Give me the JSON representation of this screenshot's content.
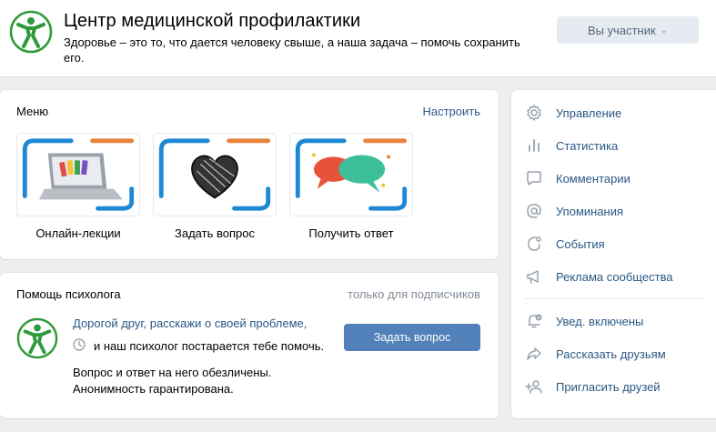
{
  "header": {
    "title": "Центр медицинской профилактики",
    "status": "Здоровье – это то, что дается человеку свыше, а наша задача – помочь сохранить его.",
    "member_button": "Вы участник"
  },
  "menu": {
    "title": "Меню",
    "configure": "Настроить",
    "tiles": [
      {
        "label": "Онлайн-лекции",
        "icon": "laptop-icon"
      },
      {
        "label": "Задать вопрос",
        "icon": "heart-icon"
      },
      {
        "label": "Получить ответ",
        "icon": "speech-bubbles-icon"
      }
    ]
  },
  "help": {
    "title": "Помощь психолога",
    "subscribers_only": "только для подписчиков",
    "line1": "Дорогой друг, расскажи о своей проблеме,",
    "line2": "и наш психолог постарается тебе помочь.",
    "line3": "Вопрос и ответ на него обезличены.",
    "line4": "Анонимность гарантирована.",
    "button": "Задать вопрос"
  },
  "sidebar": {
    "items": [
      {
        "label": "Управление",
        "icon": "gear-icon"
      },
      {
        "label": "Статистика",
        "icon": "stats-icon"
      },
      {
        "label": "Комментарии",
        "icon": "comment-icon"
      },
      {
        "label": "Упоминания",
        "icon": "at-icon"
      },
      {
        "label": "События",
        "icon": "event-icon"
      },
      {
        "label": "Реклама сообщества",
        "icon": "megaphone-icon"
      },
      {
        "label": "Увед. включены",
        "icon": "bell-check-icon"
      },
      {
        "label": "Рассказать друзьям",
        "icon": "share-icon"
      },
      {
        "label": "Пригласить друзей",
        "icon": "add-user-icon"
      }
    ]
  },
  "colors": {
    "accent": "#5181b8",
    "link": "#2a5885",
    "muted": "#818c99",
    "logo_green": "#2e9a3a",
    "frame_blue": "#1e88d4",
    "frame_orange": "#e8833a"
  }
}
